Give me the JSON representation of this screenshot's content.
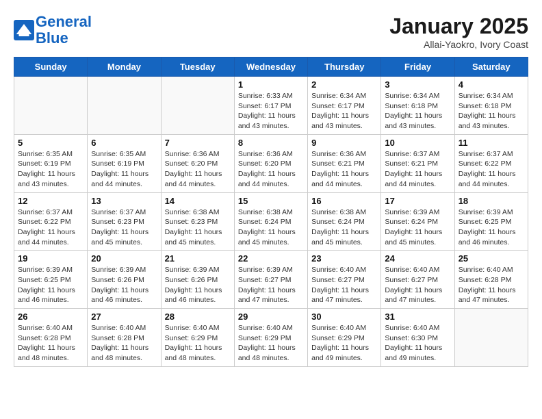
{
  "logo": {
    "line1": "General",
    "line2": "Blue"
  },
  "title": "January 2025",
  "subtitle": "Allai-Yaokro, Ivory Coast",
  "days_of_week": [
    "Sunday",
    "Monday",
    "Tuesday",
    "Wednesday",
    "Thursday",
    "Friday",
    "Saturday"
  ],
  "weeks": [
    {
      "days": [
        {
          "number": "",
          "info": ""
        },
        {
          "number": "",
          "info": ""
        },
        {
          "number": "",
          "info": ""
        },
        {
          "number": "1",
          "info": "Sunrise: 6:33 AM\nSunset: 6:17 PM\nDaylight: 11 hours\nand 43 minutes."
        },
        {
          "number": "2",
          "info": "Sunrise: 6:34 AM\nSunset: 6:17 PM\nDaylight: 11 hours\nand 43 minutes."
        },
        {
          "number": "3",
          "info": "Sunrise: 6:34 AM\nSunset: 6:18 PM\nDaylight: 11 hours\nand 43 minutes."
        },
        {
          "number": "4",
          "info": "Sunrise: 6:34 AM\nSunset: 6:18 PM\nDaylight: 11 hours\nand 43 minutes."
        }
      ]
    },
    {
      "days": [
        {
          "number": "5",
          "info": "Sunrise: 6:35 AM\nSunset: 6:19 PM\nDaylight: 11 hours\nand 43 minutes."
        },
        {
          "number": "6",
          "info": "Sunrise: 6:35 AM\nSunset: 6:19 PM\nDaylight: 11 hours\nand 44 minutes."
        },
        {
          "number": "7",
          "info": "Sunrise: 6:36 AM\nSunset: 6:20 PM\nDaylight: 11 hours\nand 44 minutes."
        },
        {
          "number": "8",
          "info": "Sunrise: 6:36 AM\nSunset: 6:20 PM\nDaylight: 11 hours\nand 44 minutes."
        },
        {
          "number": "9",
          "info": "Sunrise: 6:36 AM\nSunset: 6:21 PM\nDaylight: 11 hours\nand 44 minutes."
        },
        {
          "number": "10",
          "info": "Sunrise: 6:37 AM\nSunset: 6:21 PM\nDaylight: 11 hours\nand 44 minutes."
        },
        {
          "number": "11",
          "info": "Sunrise: 6:37 AM\nSunset: 6:22 PM\nDaylight: 11 hours\nand 44 minutes."
        }
      ]
    },
    {
      "days": [
        {
          "number": "12",
          "info": "Sunrise: 6:37 AM\nSunset: 6:22 PM\nDaylight: 11 hours\nand 44 minutes."
        },
        {
          "number": "13",
          "info": "Sunrise: 6:37 AM\nSunset: 6:23 PM\nDaylight: 11 hours\nand 45 minutes."
        },
        {
          "number": "14",
          "info": "Sunrise: 6:38 AM\nSunset: 6:23 PM\nDaylight: 11 hours\nand 45 minutes."
        },
        {
          "number": "15",
          "info": "Sunrise: 6:38 AM\nSunset: 6:24 PM\nDaylight: 11 hours\nand 45 minutes."
        },
        {
          "number": "16",
          "info": "Sunrise: 6:38 AM\nSunset: 6:24 PM\nDaylight: 11 hours\nand 45 minutes."
        },
        {
          "number": "17",
          "info": "Sunrise: 6:39 AM\nSunset: 6:24 PM\nDaylight: 11 hours\nand 45 minutes."
        },
        {
          "number": "18",
          "info": "Sunrise: 6:39 AM\nSunset: 6:25 PM\nDaylight: 11 hours\nand 46 minutes."
        }
      ]
    },
    {
      "days": [
        {
          "number": "19",
          "info": "Sunrise: 6:39 AM\nSunset: 6:25 PM\nDaylight: 11 hours\nand 46 minutes."
        },
        {
          "number": "20",
          "info": "Sunrise: 6:39 AM\nSunset: 6:26 PM\nDaylight: 11 hours\nand 46 minutes."
        },
        {
          "number": "21",
          "info": "Sunrise: 6:39 AM\nSunset: 6:26 PM\nDaylight: 11 hours\nand 46 minutes."
        },
        {
          "number": "22",
          "info": "Sunrise: 6:39 AM\nSunset: 6:27 PM\nDaylight: 11 hours\nand 47 minutes."
        },
        {
          "number": "23",
          "info": "Sunrise: 6:40 AM\nSunset: 6:27 PM\nDaylight: 11 hours\nand 47 minutes."
        },
        {
          "number": "24",
          "info": "Sunrise: 6:40 AM\nSunset: 6:27 PM\nDaylight: 11 hours\nand 47 minutes."
        },
        {
          "number": "25",
          "info": "Sunrise: 6:40 AM\nSunset: 6:28 PM\nDaylight: 11 hours\nand 47 minutes."
        }
      ]
    },
    {
      "days": [
        {
          "number": "26",
          "info": "Sunrise: 6:40 AM\nSunset: 6:28 PM\nDaylight: 11 hours\nand 48 minutes."
        },
        {
          "number": "27",
          "info": "Sunrise: 6:40 AM\nSunset: 6:28 PM\nDaylight: 11 hours\nand 48 minutes."
        },
        {
          "number": "28",
          "info": "Sunrise: 6:40 AM\nSunset: 6:29 PM\nDaylight: 11 hours\nand 48 minutes."
        },
        {
          "number": "29",
          "info": "Sunrise: 6:40 AM\nSunset: 6:29 PM\nDaylight: 11 hours\nand 48 minutes."
        },
        {
          "number": "30",
          "info": "Sunrise: 6:40 AM\nSunset: 6:29 PM\nDaylight: 11 hours\nand 49 minutes."
        },
        {
          "number": "31",
          "info": "Sunrise: 6:40 AM\nSunset: 6:30 PM\nDaylight: 11 hours\nand 49 minutes."
        },
        {
          "number": "",
          "info": ""
        }
      ]
    }
  ]
}
